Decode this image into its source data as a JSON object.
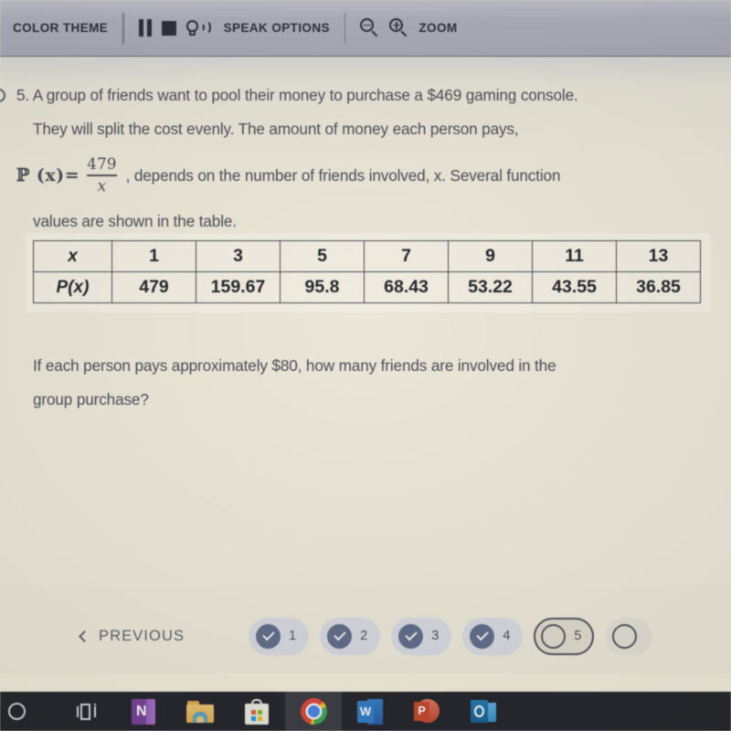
{
  "toolbar": {
    "color_theme_label": "COLOR THEME",
    "pause_icon": "pause-icon",
    "stop_icon": "stop-icon",
    "speak_icon": "speak-icon",
    "speak_options_label": "SPEAK OPTIONS",
    "zoom_out_icon": "zoom-out-icon",
    "zoom_in_icon": "zoom-in-icon",
    "zoom_label": "ZOOM"
  },
  "question": {
    "number": "5.",
    "line1": "5. A group of friends want to pool their money to purchase a $469 gaming console.",
    "line2": "They will split the cost evenly. The amount of money each person pays,",
    "formula": {
      "function_name": "ℙ",
      "variable": "x",
      "lhs": "ℙ (x)=",
      "numerator": "479",
      "denominator": "x",
      "tail": ", depends on the number of friends involved, x. Several function"
    },
    "line4": "values are shown in the table.",
    "followup_line1": "If each person pays approximately $80, how many friends are involved in the",
    "followup_line2": "group purchase?"
  },
  "chart_data": {
    "type": "table",
    "title": "Several function values of P(x) = 479/x",
    "row_headers": [
      "x",
      "P(x)"
    ],
    "categories": [
      "1",
      "3",
      "5",
      "7",
      "9",
      "11",
      "13"
    ],
    "x": [
      1,
      3,
      5,
      7,
      9,
      11,
      13
    ],
    "values": [
      479,
      159.67,
      95.8,
      68.43,
      53.22,
      43.55,
      36.85
    ],
    "series": [
      {
        "name": "x",
        "values": [
          "1",
          "3",
          "5",
          "7",
          "9",
          "11",
          "13"
        ]
      },
      {
        "name": "P(x)",
        "values": [
          "479",
          "159.67",
          "95.8",
          "68.43",
          "53.22",
          "43.55",
          "36.85"
        ]
      }
    ],
    "xlabel": "x",
    "ylabel": "P(x)"
  },
  "footer": {
    "previous_label": "PREVIOUS",
    "pager": [
      {
        "num": "1",
        "state": "complete"
      },
      {
        "num": "2",
        "state": "complete"
      },
      {
        "num": "3",
        "state": "complete"
      },
      {
        "num": "4",
        "state": "complete"
      },
      {
        "num": "5",
        "state": "current"
      },
      {
        "num": "",
        "state": "upcoming"
      }
    ]
  },
  "taskbar": {
    "items": [
      {
        "name": "cortana-icon",
        "label": ""
      },
      {
        "name": "task-view-icon",
        "label": ""
      },
      {
        "name": "onenote-icon",
        "label": "N"
      },
      {
        "name": "file-explorer-icon",
        "label": ""
      },
      {
        "name": "microsoft-store-icon",
        "label": ""
      },
      {
        "name": "chrome-icon",
        "label": ""
      },
      {
        "name": "word-icon",
        "label": "W"
      },
      {
        "name": "powerpoint-icon",
        "label": "P"
      },
      {
        "name": "outlook-icon",
        "label": "O"
      }
    ]
  },
  "colors": {
    "toolbar_bg": "#a9abb9",
    "page_bg": "#efeada",
    "text": "#4a4d58",
    "table_border": "#45474e",
    "pager_accent": "#5f6d8e",
    "taskbar_bg": "#23242a"
  }
}
